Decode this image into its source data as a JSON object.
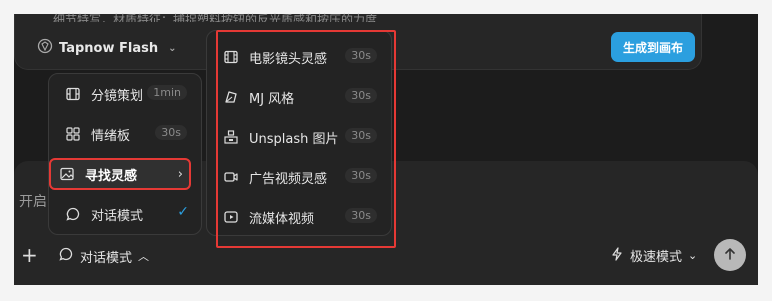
{
  "top": {
    "partial_text": "细节特写，材质特征：捕捉塑料按钮的反光质感和按压的力度",
    "model_label": "Tapnow Flash",
    "generate_label": "生成到画布"
  },
  "chat": {
    "placeholder_fragment": "开启"
  },
  "bottom": {
    "mode_label": "对话模式",
    "speed_label": "极速模式"
  },
  "menu1": {
    "items": [
      {
        "label": "分镜策划",
        "badge": "1min",
        "icon": "storyboard-icon"
      },
      {
        "label": "情绪板",
        "badge": "30s",
        "icon": "grid-icon"
      },
      {
        "label": "寻找灵感",
        "icon": "image-icon"
      },
      {
        "label": "对话模式",
        "icon": "chat-icon"
      }
    ]
  },
  "menu2": {
    "items": [
      {
        "label": "电影镜头灵感",
        "badge": "30s",
        "icon": "film-icon"
      },
      {
        "label": "MJ 风格",
        "badge": "30s",
        "icon": "mj-icon"
      },
      {
        "label": "Unsplash 图片",
        "badge": "30s",
        "icon": "unsplash-icon"
      },
      {
        "label": "广告视频灵感",
        "badge": "30s",
        "icon": "video-camera-icon"
      },
      {
        "label": "流媒体视频",
        "badge": "30s",
        "icon": "play-icon"
      }
    ]
  },
  "colors": {
    "accent_blue": "#2b9fdf",
    "highlight_red": "#e53935",
    "background": "#1c1c1c"
  }
}
